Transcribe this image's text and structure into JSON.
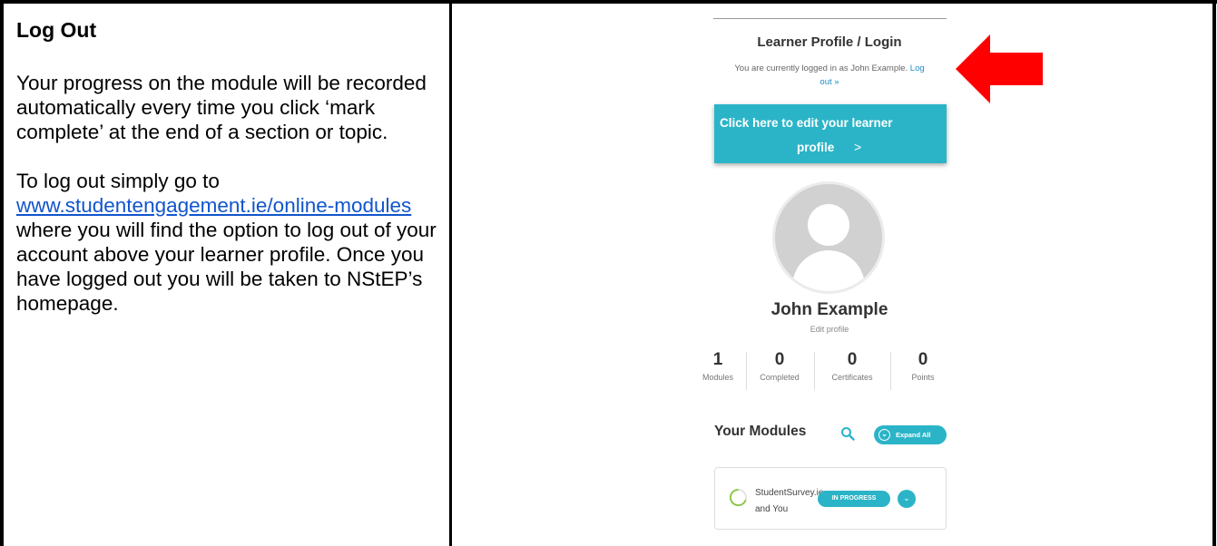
{
  "doc": {
    "heading": "Log Out",
    "para1": "Your progress on the module will be recorded automatically every time you click ‘mark complete’ at the end of a section or topic.",
    "para2_before": "To log out simply go to ",
    "para2_link": "www.studentengagement.ie/online-modules",
    "para2_after": " where you will find the option to log out of your account above your learner profile.  Once you have logged out you will be taken to NStEP’s homepage."
  },
  "profile_panel": {
    "title": "Learner Profile / Login",
    "status_text": "You are currently logged in as John Example. ",
    "logout_link": "Log out »",
    "edit_button_line1": "Click here to edit your learner",
    "edit_button_line2": "profile",
    "edit_button_chevron": ">",
    "user_name": "John Example",
    "edit_profile_link": "Edit profile",
    "stats": [
      {
        "value": "1",
        "label": "Modules"
      },
      {
        "value": "0",
        "label": "Completed"
      },
      {
        "value": "0",
        "label": "Certificates"
      },
      {
        "value": "0",
        "label": "Points"
      }
    ],
    "modules_heading": "Your Modules",
    "expand_all_label": "Expand All",
    "modules": [
      {
        "title_line1": "StudentSurvey.ie",
        "title_line2": "and You",
        "status": "IN PROGRESS"
      }
    ]
  },
  "colors": {
    "accent": "#2bb4c7",
    "link": "#1155cc",
    "arrow": "#ff0000"
  },
  "icons": {
    "search": "search-icon",
    "arrow": "red-arrow-pointer",
    "chevron": "chevron-down-icon"
  }
}
